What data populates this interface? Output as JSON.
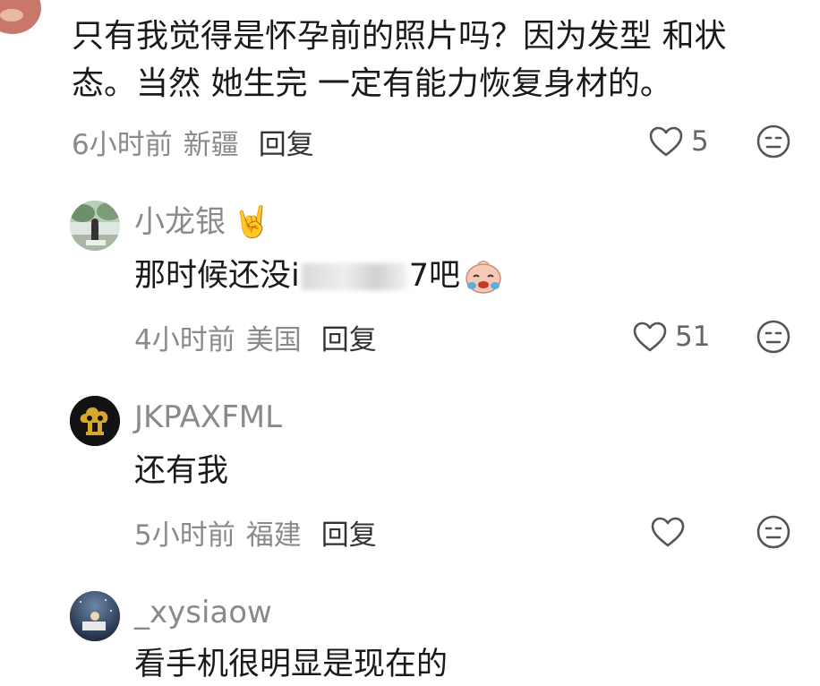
{
  "root": {
    "text": "只有我觉得是怀孕前的照片吗？因为发型 和状态。当然 她生完 一定有能力恢复身材的。",
    "time": "6小时前",
    "location": "新疆",
    "reply_label": "回复",
    "likes": "5"
  },
  "replies": [
    {
      "username": "小龙银",
      "name_emoji": "🤘",
      "text_before": "那时候还没i",
      "text_after": "7吧",
      "time": "4小时前",
      "location": "美国",
      "reply_label": "回复",
      "likes": "51"
    },
    {
      "username": "JKPAXFML",
      "text": "还有我",
      "time": "5小时前",
      "location": "福建",
      "reply_label": "回复",
      "likes": ""
    },
    {
      "username": "_xysiaow",
      "text": "看手机很明显是现在的"
    }
  ],
  "icons": {
    "like": "heart-outline-icon",
    "emoji": "neutral-face-icon"
  },
  "colors": {
    "meta_text": "#8a8a8a",
    "body_text": "#1a1a1a",
    "icon_stroke": "#555555"
  }
}
